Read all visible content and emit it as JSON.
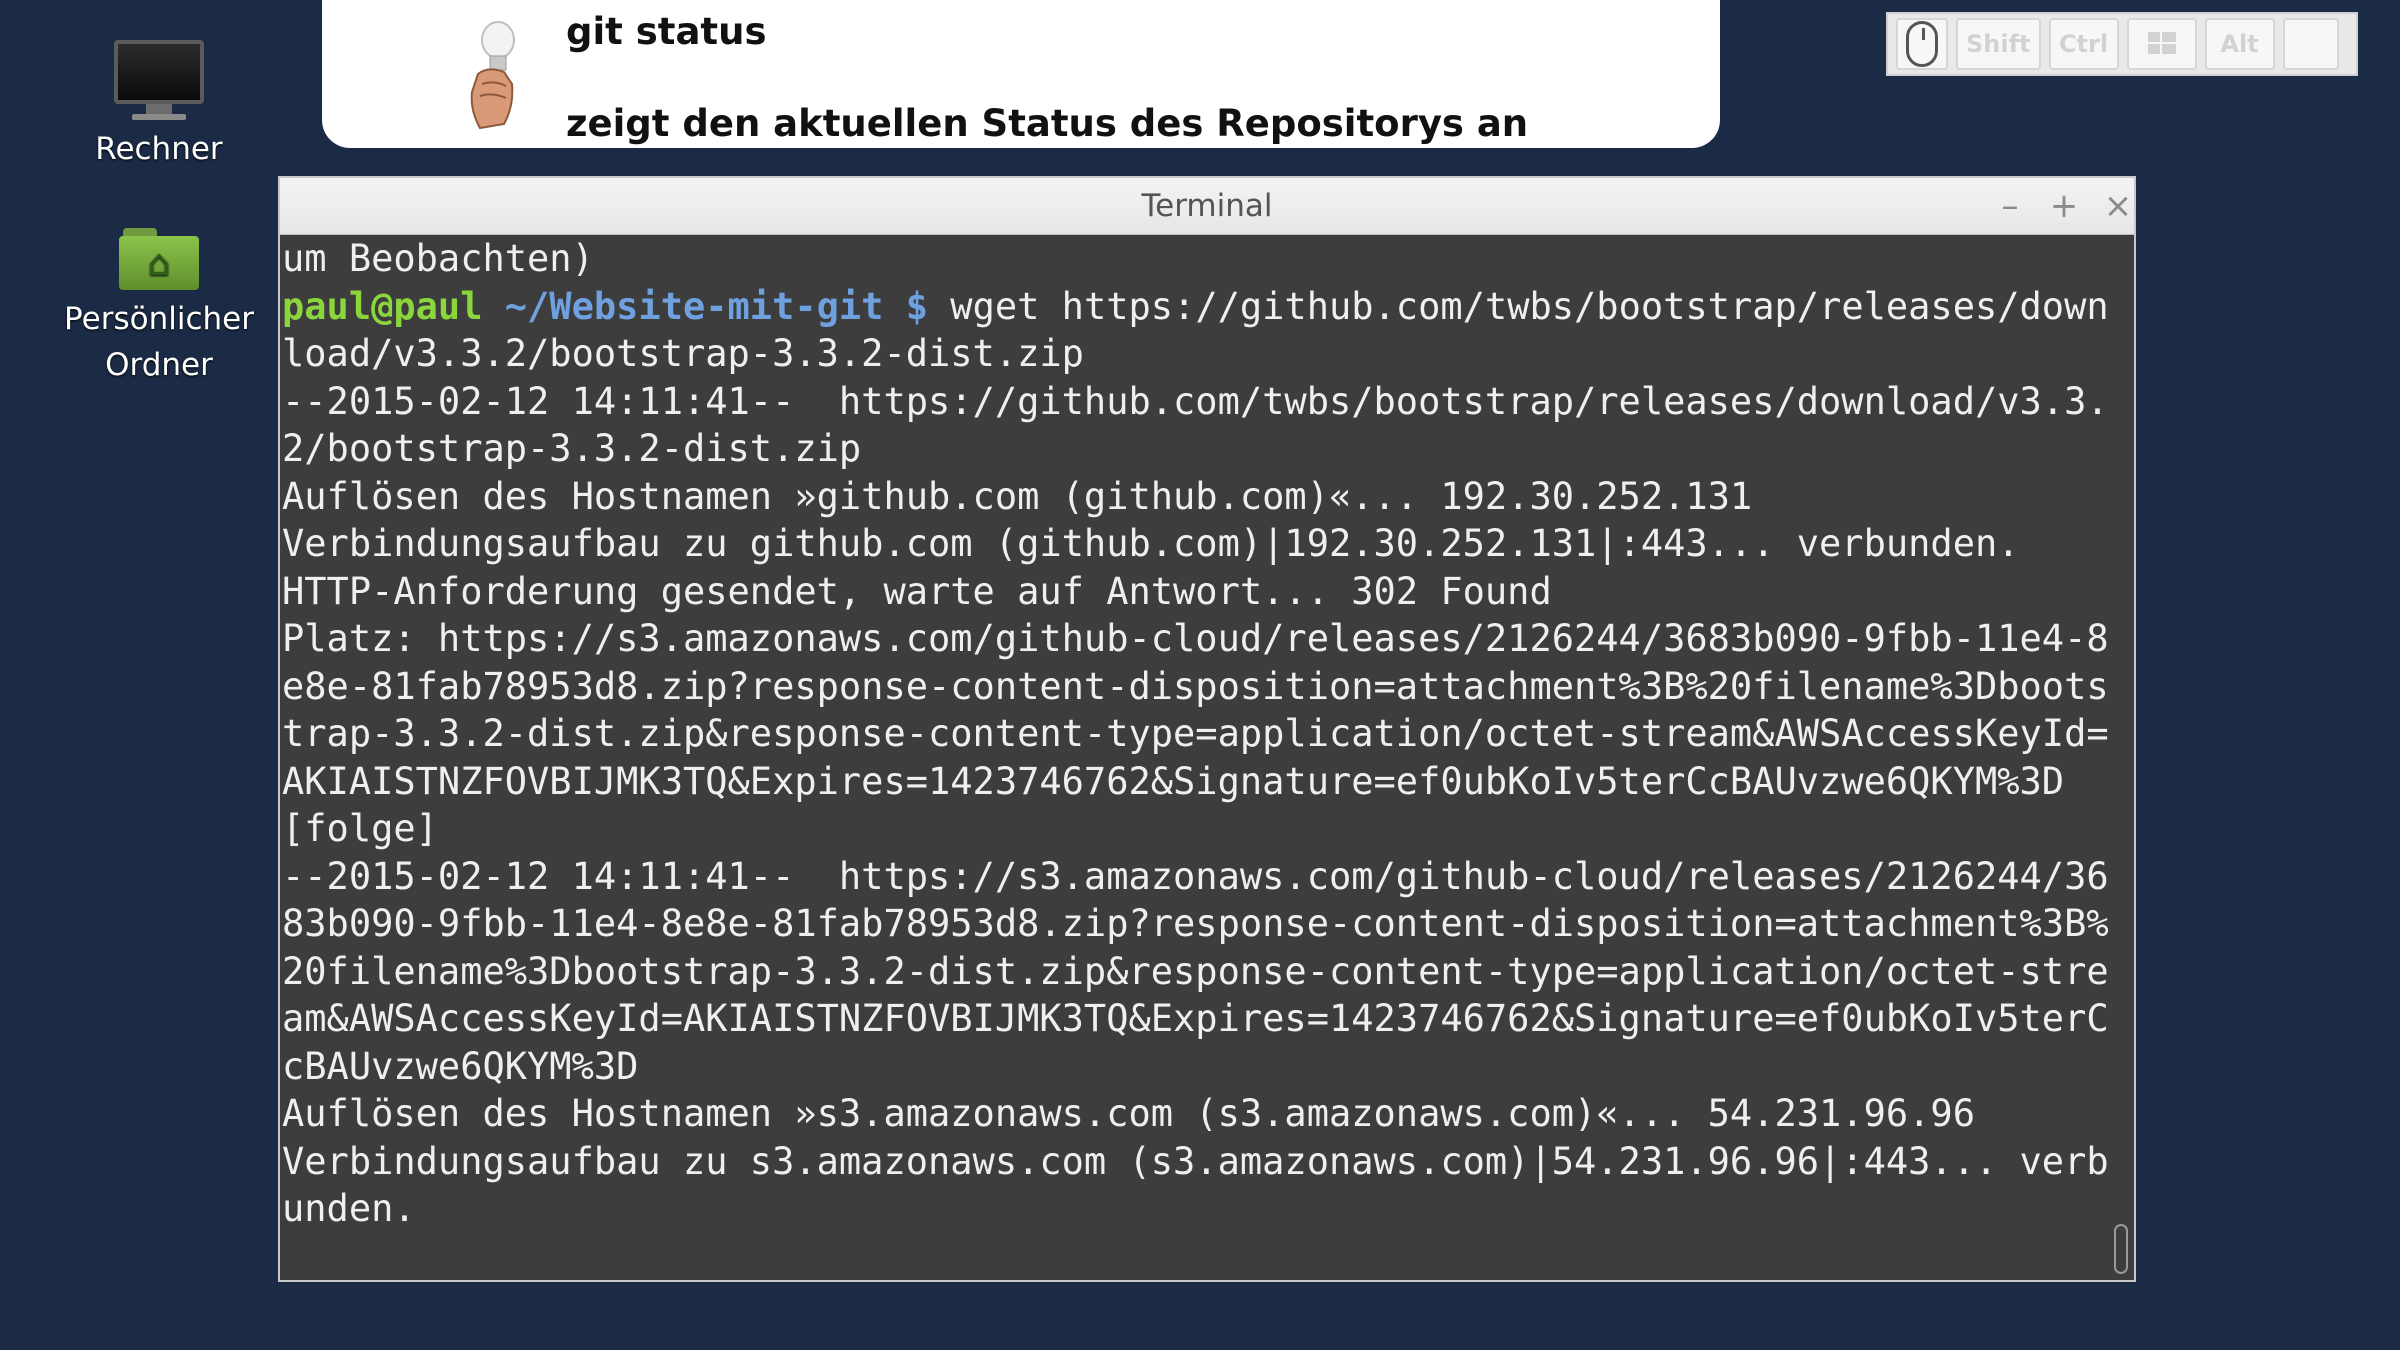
{
  "banner": {
    "title": "git status",
    "subtitle": "zeigt den aktuellen Status des Repositorys an"
  },
  "desktop": {
    "icons": [
      {
        "label": "Rechner",
        "icon": "computer-icon"
      },
      {
        "label_line1": "Persönlicher",
        "label_line2": "Ordner",
        "icon": "home-folder-icon"
      }
    ]
  },
  "keys": {
    "mouse_icon": "mouse-icon",
    "shift": "Shift",
    "ctrl": "Ctrl",
    "win_icon": "windows-key-icon",
    "alt": "Alt",
    "empty": ""
  },
  "terminal": {
    "title": "Terminal",
    "buttons": {
      "minimize": "–",
      "maximize": "+",
      "close": "×"
    },
    "prompt_user": "paul@paul",
    "prompt_path": " ~/Website-mit-git $",
    "lines_before": "um Beobachten)",
    "command": " wget https://github.com/twbs/bootstrap/releases/download/v3.3.2/bootstrap-3.3.2-dist.zip",
    "output": "--2015-02-12 14:11:41--  https://github.com/twbs/bootstrap/releases/download/v3.3.2/bootstrap-3.3.2-dist.zip\nAuflösen des Hostnamen »github.com (github.com)«... 192.30.252.131\nVerbindungsaufbau zu github.com (github.com)|192.30.252.131|:443... verbunden.\nHTTP-Anforderung gesendet, warte auf Antwort... 302 Found\nPlatz: https://s3.amazonaws.com/github-cloud/releases/2126244/3683b090-9fbb-11e4-8e8e-81fab78953d8.zip?response-content-disposition=attachment%3B%20filename%3Dbootstrap-3.3.2-dist.zip&response-content-type=application/octet-stream&AWSAccessKeyId=AKIAISTNZFOVBIJMK3TQ&Expires=1423746762&Signature=ef0ubKoIv5terCcBAUvzwe6QKYM%3D [folge]\n--2015-02-12 14:11:41--  https://s3.amazonaws.com/github-cloud/releases/2126244/3683b090-9fbb-11e4-8e8e-81fab78953d8.zip?response-content-disposition=attachment%3B%20filename%3Dbootstrap-3.3.2-dist.zip&response-content-type=application/octet-stream&AWSAccessKeyId=AKIAISTNZFOVBIJMK3TQ&Expires=1423746762&Signature=ef0ubKoIv5terCcBAUvzwe6QKYM%3D\nAuflösen des Hostnamen »s3.amazonaws.com (s3.amazonaws.com)«... 54.231.96.96\nVerbindungsaufbau zu s3.amazonaws.com (s3.amazonaws.com)|54.231.96.96|:443... verbunden."
  },
  "colors": {
    "desktop_bg": "#1b2b45",
    "terminal_bg": "#3d3d3d",
    "prompt_user": "#8bd63c",
    "prompt_path": "#6fa0e0"
  }
}
